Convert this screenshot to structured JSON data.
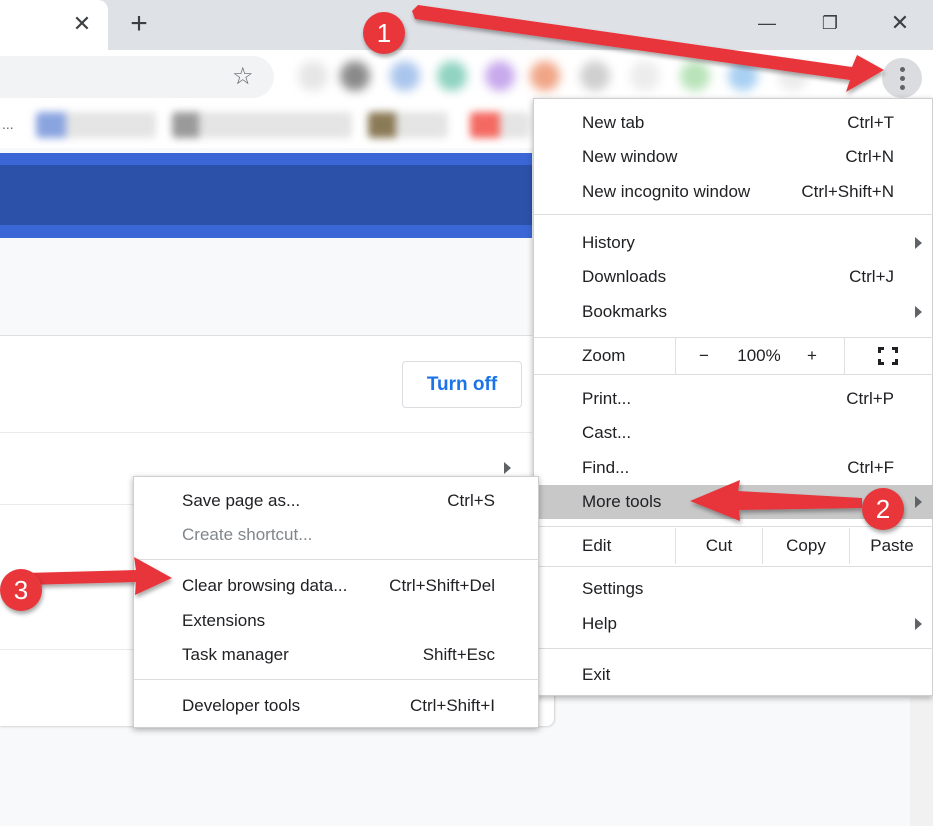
{
  "browser": {
    "tab_close_glyph": "✕",
    "new_tab_glyph": "+",
    "window_controls": {
      "minimize": "—",
      "maximize": "❐",
      "close": "✕"
    },
    "bookmark_star_glyph": "☆",
    "bookmarks_overflow": "..."
  },
  "page": {
    "turn_off_label": "Turn off"
  },
  "menu": {
    "items_top": [
      {
        "label": "New tab",
        "shortcut": "Ctrl+T"
      },
      {
        "label": "New window",
        "shortcut": "Ctrl+N"
      },
      {
        "label": "New incognito window",
        "shortcut": "Ctrl+Shift+N"
      }
    ],
    "items_mid": [
      {
        "label": "History",
        "shortcut": "",
        "submenu": true
      },
      {
        "label": "Downloads",
        "shortcut": "Ctrl+J"
      },
      {
        "label": "Bookmarks",
        "shortcut": "",
        "submenu": true
      }
    ],
    "zoom": {
      "label": "Zoom",
      "minus": "−",
      "value": "100%",
      "plus": "+"
    },
    "items_tools": [
      {
        "label": "Print...",
        "shortcut": "Ctrl+P"
      },
      {
        "label": "Cast...",
        "shortcut": ""
      },
      {
        "label": "Find...",
        "shortcut": "Ctrl+F"
      },
      {
        "label": "More tools",
        "shortcut": "",
        "submenu": true,
        "highlighted": true
      }
    ],
    "edit": {
      "label": "Edit",
      "cut": "Cut",
      "copy": "Copy",
      "paste": "Paste"
    },
    "items_bottom": [
      {
        "label": "Settings",
        "shortcut": ""
      },
      {
        "label": "Help",
        "shortcut": "",
        "submenu": true
      }
    ],
    "exit": {
      "label": "Exit"
    }
  },
  "submenu": {
    "items": [
      {
        "label": "Save page as...",
        "shortcut": "Ctrl+S"
      },
      {
        "label": "Create shortcut...",
        "shortcut": "",
        "disabled": true
      },
      {
        "label": "Clear browsing data...",
        "shortcut": "Ctrl+Shift+Del"
      },
      {
        "label": "Extensions",
        "shortcut": ""
      },
      {
        "label": "Task manager",
        "shortcut": "Shift+Esc"
      },
      {
        "label": "Developer tools",
        "shortcut": "Ctrl+Shift+I"
      }
    ]
  },
  "annotations": {
    "step1": "1",
    "step2": "2",
    "step3": "3",
    "color": "#e8363a"
  }
}
